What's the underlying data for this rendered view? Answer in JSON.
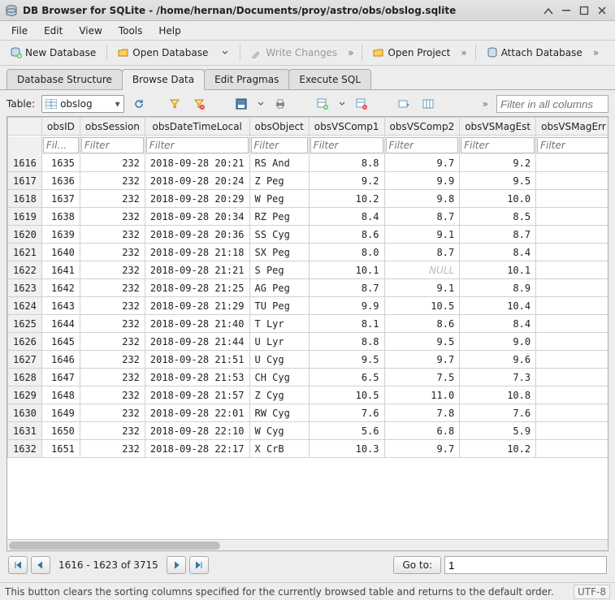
{
  "window": {
    "title": "DB Browser for SQLite - /home/hernan/Documents/proy/astro/obs/obslog.sqlite"
  },
  "menu": {
    "file": "File",
    "edit": "Edit",
    "view": "View",
    "tools": "Tools",
    "help": "Help"
  },
  "toolbar": {
    "new_db": "New Database",
    "open_db": "Open Database",
    "write_changes": "Write Changes",
    "open_project": "Open Project",
    "attach_db": "Attach Database"
  },
  "tabs": {
    "structure": "Database Structure",
    "browse": "Browse Data",
    "pragmas": "Edit Pragmas",
    "sql": "Execute SQL"
  },
  "browse": {
    "table_label": "Table:",
    "table_name": "obslog",
    "filter_all_placeholder": "Filter in all columns"
  },
  "columns": [
    "obsID",
    "obsSession",
    "obsDateTimeLocal",
    "obsObject",
    "obsVSComp1",
    "obsVSComp2",
    "obsVSMagEst",
    "obsVSMagErr"
  ],
  "filter_placeholder_short": "Fil…",
  "filter_placeholder": "Filter",
  "rows": [
    {
      "n": 1616,
      "obsID": 1635,
      "obsSession": 232,
      "dt": "2018-09-28 20:21",
      "obj": "RS And",
      "c1": "8.8",
      "c2": "9.7",
      "mag": "9.2"
    },
    {
      "n": 1617,
      "obsID": 1636,
      "obsSession": 232,
      "dt": "2018-09-28 20:24",
      "obj": "Z Peg",
      "c1": "9.2",
      "c2": "9.9",
      "mag": "9.5"
    },
    {
      "n": 1618,
      "obsID": 1637,
      "obsSession": 232,
      "dt": "2018-09-28 20:29",
      "obj": "W Peg",
      "c1": "10.2",
      "c2": "9.8",
      "mag": "10.0"
    },
    {
      "n": 1619,
      "obsID": 1638,
      "obsSession": 232,
      "dt": "2018-09-28 20:34",
      "obj": "RZ Peg",
      "c1": "8.4",
      "c2": "8.7",
      "mag": "8.5"
    },
    {
      "n": 1620,
      "obsID": 1639,
      "obsSession": 232,
      "dt": "2018-09-28 20:36",
      "obj": "SS Cyg",
      "c1": "8.6",
      "c2": "9.1",
      "mag": "8.7"
    },
    {
      "n": 1621,
      "obsID": 1640,
      "obsSession": 232,
      "dt": "2018-09-28 21:18",
      "obj": "SX Peg",
      "c1": "8.0",
      "c2": "8.7",
      "mag": "8.4"
    },
    {
      "n": 1622,
      "obsID": 1641,
      "obsSession": 232,
      "dt": "2018-09-28 21:21",
      "obj": "S Peg",
      "c1": "10.1",
      "c2": null,
      "mag": "10.1"
    },
    {
      "n": 1623,
      "obsID": 1642,
      "obsSession": 232,
      "dt": "2018-09-28 21:25",
      "obj": "AG Peg",
      "c1": "8.7",
      "c2": "9.1",
      "mag": "8.9"
    },
    {
      "n": 1624,
      "obsID": 1643,
      "obsSession": 232,
      "dt": "2018-09-28 21:29",
      "obj": "TU Peg",
      "c1": "9.9",
      "c2": "10.5",
      "mag": "10.4"
    },
    {
      "n": 1625,
      "obsID": 1644,
      "obsSession": 232,
      "dt": "2018-09-28 21:40",
      "obj": "T Lyr",
      "c1": "8.1",
      "c2": "8.6",
      "mag": "8.4"
    },
    {
      "n": 1626,
      "obsID": 1645,
      "obsSession": 232,
      "dt": "2018-09-28 21:44",
      "obj": "U Lyr",
      "c1": "8.8",
      "c2": "9.5",
      "mag": "9.0"
    },
    {
      "n": 1627,
      "obsID": 1646,
      "obsSession": 232,
      "dt": "2018-09-28 21:51",
      "obj": "U Cyg",
      "c1": "9.5",
      "c2": "9.7",
      "mag": "9.6"
    },
    {
      "n": 1628,
      "obsID": 1647,
      "obsSession": 232,
      "dt": "2018-09-28 21:53",
      "obj": "CH Cyg",
      "c1": "6.5",
      "c2": "7.5",
      "mag": "7.3"
    },
    {
      "n": 1629,
      "obsID": 1648,
      "obsSession": 232,
      "dt": "2018-09-28 21:57",
      "obj": "Z Cyg",
      "c1": "10.5",
      "c2": "11.0",
      "mag": "10.8"
    },
    {
      "n": 1630,
      "obsID": 1649,
      "obsSession": 232,
      "dt": "2018-09-28 22:01",
      "obj": "RW Cyg",
      "c1": "7.6",
      "c2": "7.8",
      "mag": "7.6"
    },
    {
      "n": 1631,
      "obsID": 1650,
      "obsSession": 232,
      "dt": "2018-09-28 22:10",
      "obj": "W Cyg",
      "c1": "5.6",
      "c2": "6.8",
      "mag": "5.9"
    },
    {
      "n": 1632,
      "obsID": 1651,
      "obsSession": 232,
      "dt": "2018-09-28 22:17",
      "obj": "X CrB",
      "c1": "10.3",
      "c2": "9.7",
      "mag": "10.2"
    }
  ],
  "null_text": "NULL",
  "pager": {
    "range": "1616 - 1623 of 3715",
    "goto_label": "Go to:",
    "goto_value": "1"
  },
  "status": {
    "msg": "This button clears the sorting columns specified for the currently browsed table and returns to the default order.",
    "encoding": "UTF-8"
  }
}
